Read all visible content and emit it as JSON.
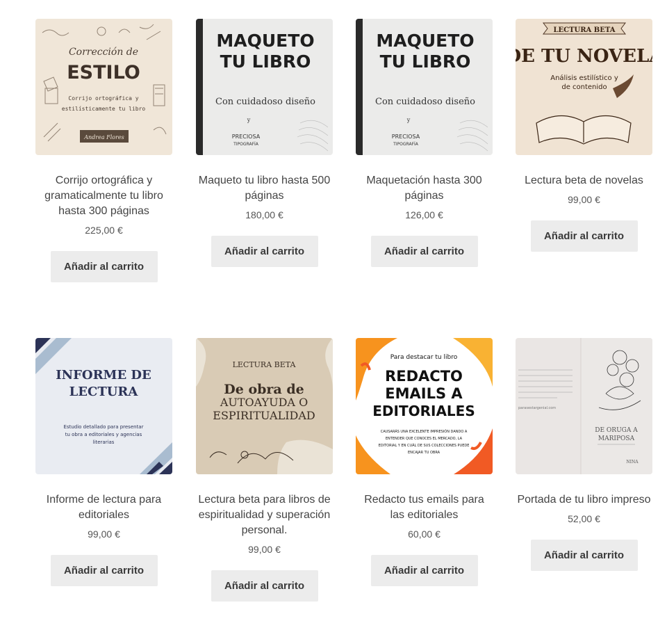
{
  "products": [
    {
      "title": "Corrijo ortográfica y gramaticalmente tu libro hasta 300 páginas",
      "price": "225,00 €",
      "button": "Añadir al carrito",
      "image": {
        "heading_small": "Corrección de",
        "heading_big": "ESTILO",
        "sub1": "Corrijo ortográfica y",
        "sub2": "estilísticamente tu libro",
        "signature": "Andrea Flores"
      }
    },
    {
      "title": "Maqueto tu libro hasta 500 páginas",
      "price": "180,00 €",
      "button": "Añadir al carrito",
      "image": {
        "line1": "MAQUETO",
        "line2": "TU LIBRO",
        "sub": "Con cuidadoso diseño",
        "y": "y",
        "bottom1": "PRECIOSA",
        "bottom2": "TIPOGRAFÍA"
      }
    },
    {
      "title": "Maquetación hasta 300 páginas",
      "price": "126,00 €",
      "button": "Añadir al carrito",
      "image": {
        "line1": "MAQUETO",
        "line2": "TU LIBRO",
        "sub": "Con cuidadoso diseño",
        "y": "y",
        "bottom1": "PRECIOSA",
        "bottom2": "TIPOGRAFÍA"
      }
    },
    {
      "title": "Lectura beta de novelas",
      "price": "99,00 €",
      "button": "Añadir al carrito",
      "image": {
        "banner": "LECTURA BETA",
        "heading": "DE TU NOVELA",
        "sub1": "Análisis estilístico y",
        "sub2": "de contenido"
      }
    },
    {
      "title": "Informe de lectura para editoriales",
      "price": "99,00 €",
      "button": "Añadir al carrito",
      "image": {
        "heading1": "INFORME DE",
        "heading2": "LECTURA",
        "sub1": "Estudio detallado para presentar",
        "sub2": "tu obra a editoriales y agencias",
        "sub3": "literarias"
      }
    },
    {
      "title": "Lectura beta para libros de espiritualidad y superación personal.",
      "price": "99,00 €",
      "button": "Añadir al carrito",
      "image": {
        "banner": "LECTURA BETA",
        "line1": "De obra de",
        "line2": "AUTOAYUDA O",
        "line3": "ESPIRITUALIDAD"
      }
    },
    {
      "title": "Redacto tus emails para las editoriales",
      "price": "60,00 €",
      "button": "Añadir al carrito",
      "image": {
        "arc": "Para destacar tu libro",
        "line1": "REDACTO",
        "line2": "EMAILS A",
        "line3": "EDITORIALES",
        "small1": "CAUSARÁS UNA EXCELENTE IMPRESIÓN DANDO A",
        "small2": "ENTENDER QUE CONOCES EL MERCADO, LA",
        "small3": "EDITORIAL Y EN CUÁL DE SUS COLECCIONES PUEDE",
        "small4": "ENCAJAR TU OBRA"
      }
    },
    {
      "title": "Portada de tu libro impreso",
      "price": "52,00 €",
      "button": "Añadir al carrito",
      "image": {
        "title1": "DE ORUGA A",
        "title2": "MARIPOSA",
        "author": "NINA",
        "url": "parasestargenial.com"
      }
    }
  ],
  "colors": {
    "button_bg": "#ececec",
    "text": "#444444",
    "navy": "#2c3357",
    "orange": "#f7931e"
  }
}
